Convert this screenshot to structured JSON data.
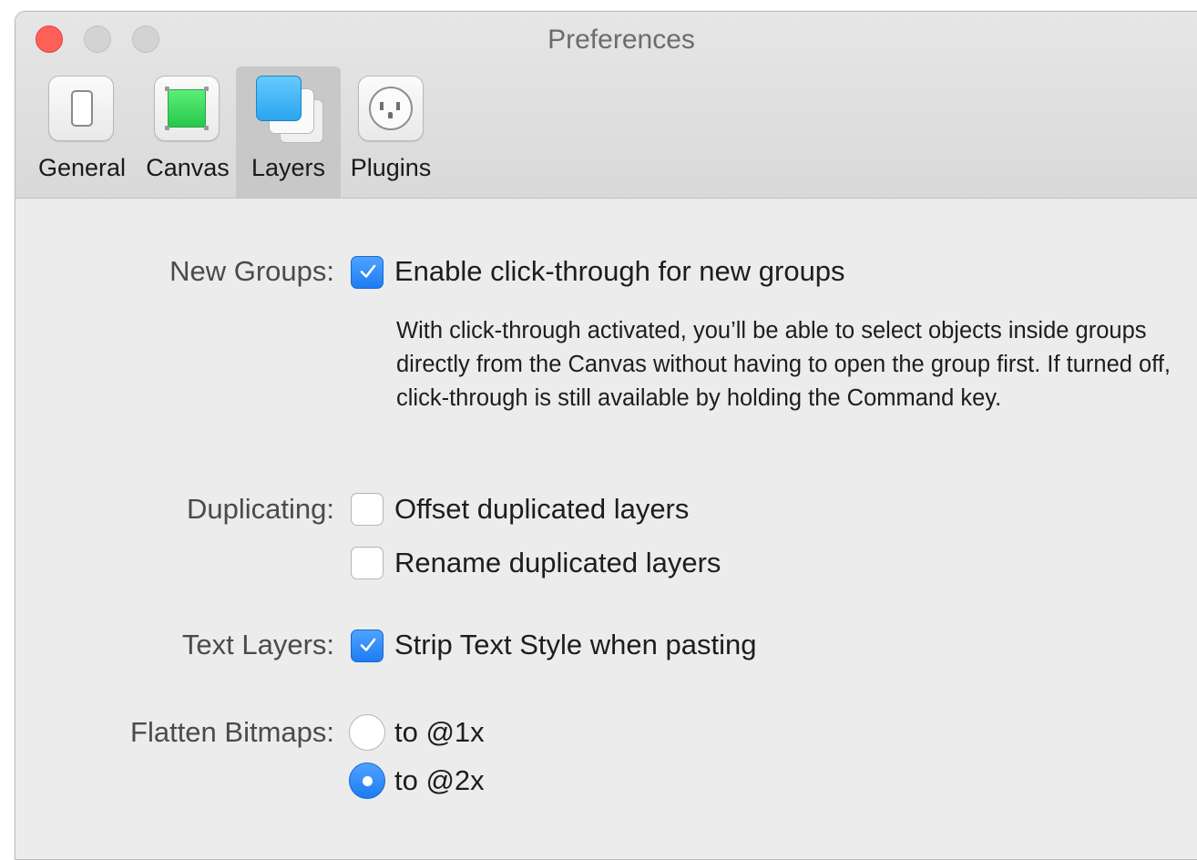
{
  "window": {
    "title": "Preferences"
  },
  "toolbar": {
    "items": [
      {
        "label": "General",
        "icon": "phone-icon"
      },
      {
        "label": "Canvas",
        "icon": "canvas-icon"
      },
      {
        "label": "Layers",
        "icon": "layers-icon",
        "selected": true
      },
      {
        "label": "Plugins",
        "icon": "plug-outlet-icon"
      }
    ]
  },
  "settings": {
    "new_groups": {
      "label": "New Groups:",
      "checkbox_label": "Enable click-through for new groups",
      "checked": true,
      "description": "With click-through activated, you’ll be able to select objects inside groups directly from the Canvas without having to open the group first. If turned off, click-through is still available by holding the Command key."
    },
    "duplicating": {
      "label": "Duplicating:",
      "options": [
        {
          "label": "Offset duplicated layers",
          "checked": false
        },
        {
          "label": "Rename duplicated layers",
          "checked": false
        }
      ]
    },
    "text_layers": {
      "label": "Text Layers:",
      "checkbox_label": "Strip Text Style when pasting",
      "checked": true
    },
    "flatten_bitmaps": {
      "label": "Flatten Bitmaps:",
      "options": [
        {
          "label": "to @1x",
          "selected": false
        },
        {
          "label": "to @2x",
          "selected": true
        }
      ]
    }
  },
  "colors": {
    "accent": "#1c7cf2",
    "close": "#fe5f57",
    "background": "#ececec"
  }
}
